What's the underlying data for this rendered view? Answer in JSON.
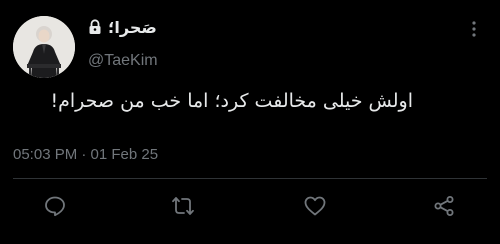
{
  "user": {
    "display_name": "صَحرا؛",
    "handle": "@TaeKim",
    "protected_icon": "lock-icon",
    "avatar_icon": "profile-photo"
  },
  "tweet": {
    "text": "اولش خیلی مخالفت کرد؛ اما خب من صحرام!",
    "timestamp": "05:03 PM · 01 Feb 25"
  },
  "actions": [
    {
      "name": "reply",
      "icon": "reply-icon"
    },
    {
      "name": "retweet",
      "icon": "retweet-icon"
    },
    {
      "name": "like",
      "icon": "heart-icon"
    },
    {
      "name": "share",
      "icon": "share-icon"
    }
  ],
  "more_icon": "more-vertical-icon",
  "colors": {
    "background": "#000000",
    "text_primary": "#e7e9ea",
    "text_secondary": "#71767b",
    "divider": "#2f3336"
  }
}
